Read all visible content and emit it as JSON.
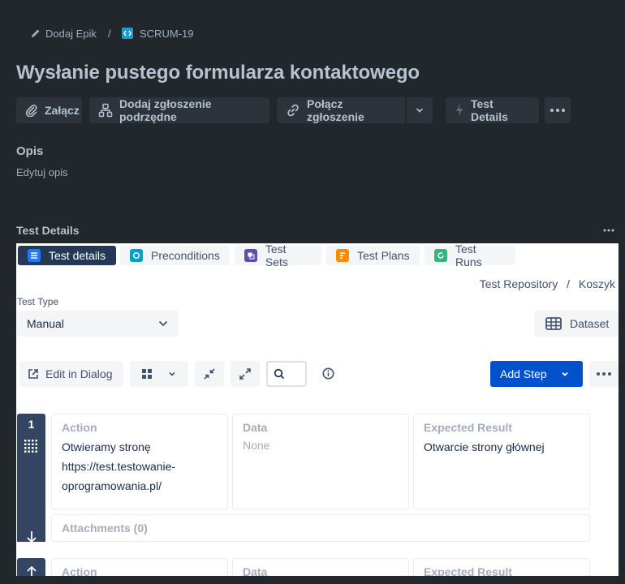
{
  "breadcrumb": {
    "epic_label": "Dodaj Epik",
    "separator": "/",
    "issue_key": "SCRUM-19"
  },
  "issue": {
    "title": "Wysłanie pustego formularza kontaktowego"
  },
  "toolbar": {
    "attach_label": "Załącz",
    "child_label": "Dodaj zgłoszenie podrzędne",
    "link_label": "Połącz zgłoszenie",
    "test_details_label": "Test Details"
  },
  "description": {
    "heading": "Opis",
    "placeholder": "Edytuj opis"
  },
  "test_details_section": {
    "heading": "Test Details"
  },
  "tabs": [
    {
      "label": "Test details",
      "icon": "list-icon",
      "color": "#1d7afc"
    },
    {
      "label": "Preconditions",
      "icon": "precondition-icon",
      "color": "#00a3bf"
    },
    {
      "label": "Test Sets",
      "icon": "test-sets-icon",
      "color": "#5e4db2"
    },
    {
      "label": "Test Plans",
      "icon": "test-plans-icon",
      "color": "#ff8b00"
    },
    {
      "label": "Test Runs",
      "icon": "test-runs-icon",
      "color": "#36b37e"
    }
  ],
  "repository": {
    "root": "Test Repository",
    "separator": "/",
    "folder": "Koszyk"
  },
  "test_type": {
    "label": "Test Type",
    "value": "Manual"
  },
  "controls": {
    "dataset_label": "Dataset",
    "edit_dialog_label": "Edit in Dialog",
    "add_step_label": "Add Step"
  },
  "steps": [
    {
      "number": "1",
      "action_label": "Action",
      "action_lines": [
        "Otwieramy stronę",
        "https://test.testowanie-",
        "oprogramowania.pl/"
      ],
      "data_label": "Data",
      "data_value": "None",
      "expected_label": "Expected Result",
      "expected_value": "Otwarcie strony głównej",
      "attachments_label": "Attachments (0)"
    },
    {
      "action_label": "Action",
      "data_label": "Data",
      "expected_label": "Expected Result"
    }
  ],
  "colors": {
    "page_bg": "#22272b",
    "panel_bg": "#ffffff",
    "primary": "#0052cc",
    "active_tab": "#253858",
    "step_rail": "#344563"
  }
}
